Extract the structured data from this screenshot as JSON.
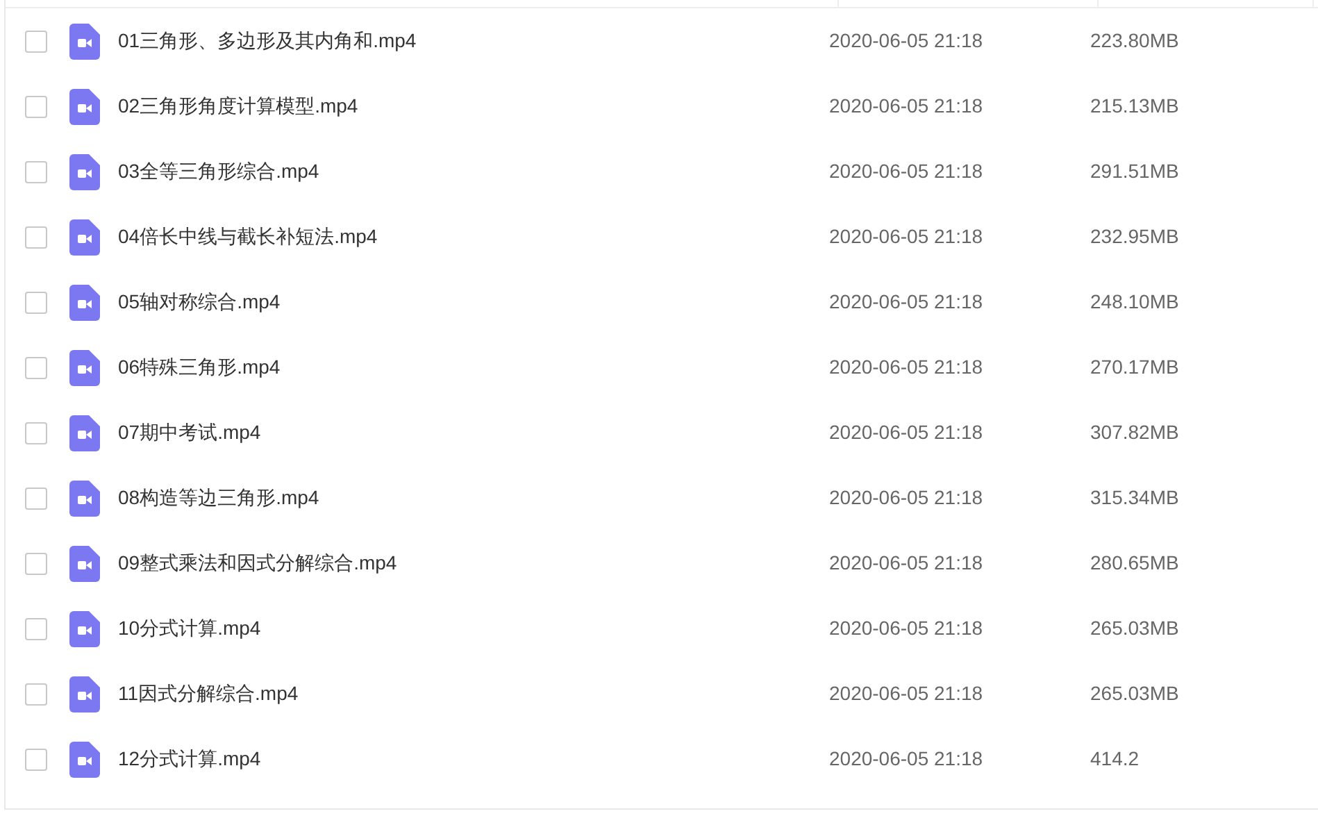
{
  "files": [
    {
      "name": "01三角形、多边形及其内角和.mp4",
      "date": "2020-06-05 21:18",
      "size": "223.80MB",
      "checked": false
    },
    {
      "name": "02三角形角度计算模型.mp4",
      "date": "2020-06-05 21:18",
      "size": "215.13MB",
      "checked": false
    },
    {
      "name": "03全等三角形综合.mp4",
      "date": "2020-06-05 21:18",
      "size": "291.51MB",
      "checked": false
    },
    {
      "name": "04倍长中线与截长补短法.mp4",
      "date": "2020-06-05 21:18",
      "size": "232.95MB",
      "checked": false
    },
    {
      "name": "05轴对称综合.mp4",
      "date": "2020-06-05 21:18",
      "size": "248.10MB",
      "checked": false
    },
    {
      "name": "06特殊三角形.mp4",
      "date": "2020-06-05 21:18",
      "size": "270.17MB",
      "checked": false
    },
    {
      "name": "07期中考试.mp4",
      "date": "2020-06-05 21:18",
      "size": "307.82MB",
      "checked": false
    },
    {
      "name": "08构造等边三角形.mp4",
      "date": "2020-06-05 21:18",
      "size": "315.34MB",
      "checked": false
    },
    {
      "name": "09整式乘法和因式分解综合.mp4",
      "date": "2020-06-05 21:18",
      "size": "280.65MB",
      "checked": false
    },
    {
      "name": "10分式计算.mp4",
      "date": "2020-06-05 21:18",
      "size": "265.03MB",
      "checked": false
    },
    {
      "name": "11因式分解综合.mp4",
      "date": "2020-06-05 21:18",
      "size": "265.03MB",
      "checked": false
    },
    {
      "name": "12分式计算.mp4",
      "date": "2020-06-05 21:18",
      "size": "414.2",
      "checked": false
    }
  ]
}
